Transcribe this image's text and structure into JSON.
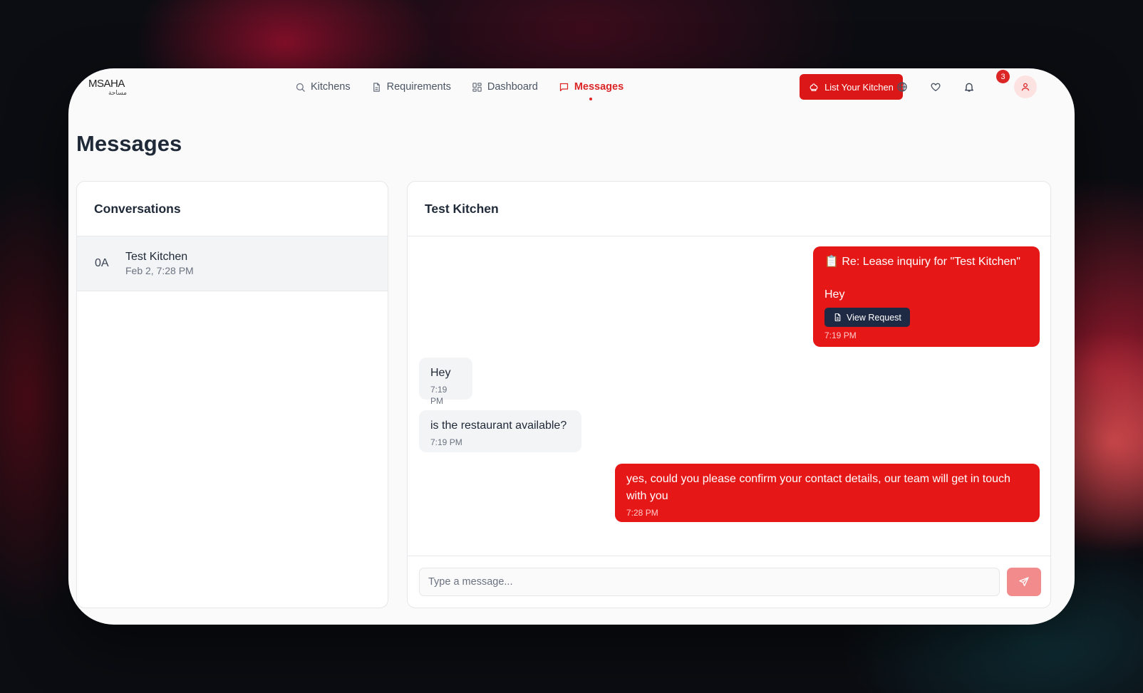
{
  "brand": {
    "logo_text": "MSAHA",
    "logo_arabic": "مساحة"
  },
  "nav": {
    "items": [
      {
        "label": "Kitchens",
        "icon": "search-icon"
      },
      {
        "label": "Requirements",
        "icon": "document-icon"
      },
      {
        "label": "Dashboard",
        "icon": "dashboard-icon"
      },
      {
        "label": "Messages",
        "icon": "message-icon",
        "active": true
      }
    ],
    "list_button": "List Your Kitchen",
    "notification_count": "3"
  },
  "page": {
    "title": "Messages"
  },
  "conversations": {
    "title": "Conversations",
    "items": [
      {
        "initials": "0A",
        "name": "Test Kitchen",
        "date": "Feb 2, 7:28 PM"
      }
    ]
  },
  "chat": {
    "title": "Test Kitchen",
    "messages": [
      {
        "direction": "out",
        "subject": "📋 Re: Lease inquiry for \"Test Kitchen\"",
        "text": "Hey",
        "button": "View Request",
        "time": "7:19 PM"
      },
      {
        "direction": "in",
        "text": "Hey",
        "time": "7:19 PM"
      },
      {
        "direction": "in",
        "text": "is the restaurant available?",
        "time": "7:19 PM"
      },
      {
        "direction": "out",
        "text": "yes, could you please confirm your contact details, our team will get in touch with you",
        "time": "7:28 PM"
      }
    ],
    "input_placeholder": "Type a message..."
  },
  "colors": {
    "accent": "#dc2626",
    "outgoing_bubble": "#e51717",
    "incoming_bubble": "#f3f4f6",
    "view_button": "#1e2a44",
    "send_button": "#f28b8b"
  }
}
